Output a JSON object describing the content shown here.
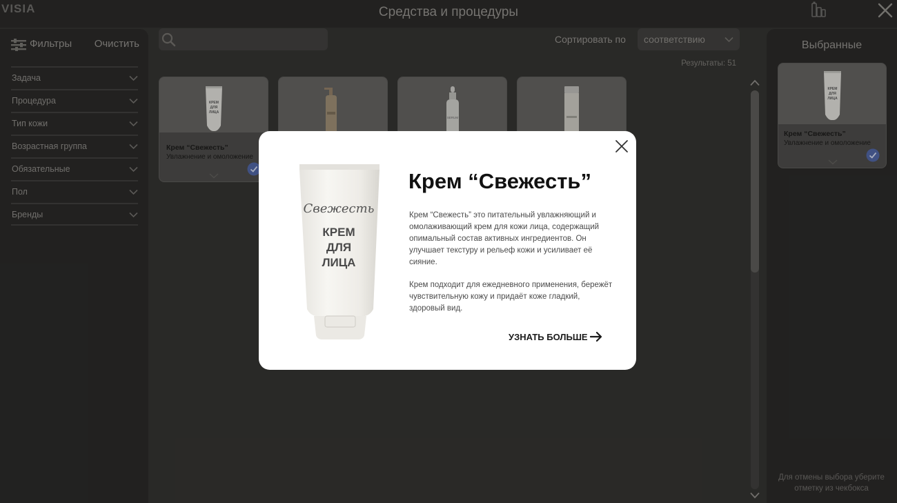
{
  "app": {
    "logo": "VISIA",
    "title": "Средства и процедуры"
  },
  "filters": {
    "label": "Фильтры",
    "clear_label": "Очистить",
    "items": [
      {
        "label": "Задача"
      },
      {
        "label": "Процедура"
      },
      {
        "label": "Тип кожи"
      },
      {
        "label": "Возрастная группа"
      },
      {
        "label": "Обязательные"
      },
      {
        "label": "Пол"
      },
      {
        "label": "Бренды"
      }
    ]
  },
  "search": {
    "value": "",
    "placeholder": ""
  },
  "sort": {
    "label": "Сортировать по",
    "selected": "соответствию"
  },
  "results": {
    "text": "Результаты: 51"
  },
  "products": [
    {
      "title": "Крем “Свежесть”",
      "subtitle": "Увлажнение и омоложение",
      "selected": true,
      "image_text": "КРЕМ ДЛЯ ЛИЦА"
    },
    {
      "title": "",
      "subtitle": "",
      "selected": false
    },
    {
      "title": "",
      "subtitle": "",
      "selected": false,
      "image_text": "SERUM"
    },
    {
      "title": "",
      "subtitle": "",
      "selected": false
    }
  ],
  "selected_panel": {
    "title": "Выбранные",
    "items": [
      {
        "title": "Крем “Свежесть”",
        "subtitle": "Увлажнение и омоложение",
        "image_text": "КРЕМ ДЛЯ ЛИЦА"
      }
    ],
    "hint": "Для отмены выбора уберите отметку из чекбокса"
  },
  "modal": {
    "title": "Крем “Свежесть”",
    "paragraphs": [
      "Крем “Свежесть” это питательный увлажняющий и омолаживающий крем для кожи лица, содержащий опимальный состав активных ингредиентов. Он улучшает текстуру  и рельеф кожи и усиливает её сияние.",
      "Крем подходит для ежедневного применения, бережёт чувствительную кожу и придаёт коже гладкий, здоровый вид."
    ],
    "product": {
      "brand_script": "Свежесть",
      "label_lines": [
        "КРЕМ",
        "ДЛЯ",
        "ЛИЦА"
      ]
    },
    "learn_more_label": "УЗНАТЬ БОЛЬШЕ"
  },
  "colors": {
    "background": "#333230",
    "panel": "#2a2928",
    "accent_check": "#5a6ea8",
    "modal_bg": "#ffffff"
  }
}
